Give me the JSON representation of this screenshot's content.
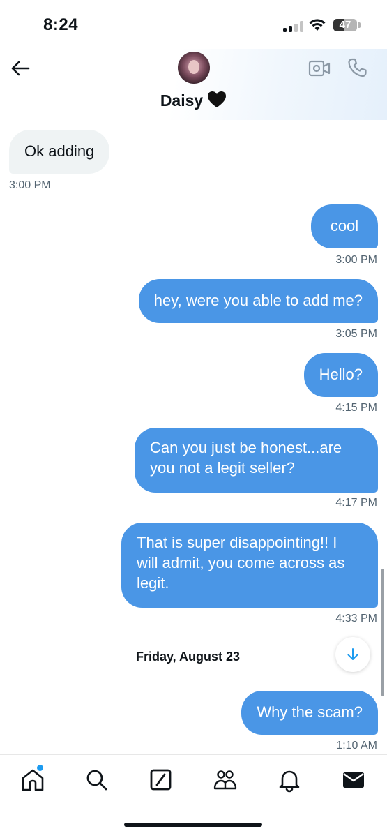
{
  "status_bar": {
    "time": "8:24",
    "battery_level": "47"
  },
  "header": {
    "contact_name": "Daisy",
    "name_emoji_icon": "black-heart-icon",
    "back_icon": "back-arrow-icon",
    "video_icon": "video-camera-icon",
    "phone_icon": "phone-icon"
  },
  "messages": [
    {
      "direction": "in",
      "text": "Ok adding",
      "time": "3:00 PM"
    },
    {
      "direction": "out",
      "text": "cool",
      "time": "3:00 PM"
    },
    {
      "direction": "out",
      "text": "hey, were you able to add me?",
      "time": "3:05 PM"
    },
    {
      "direction": "out",
      "text": "Hello?",
      "time": "4:15 PM"
    },
    {
      "direction": "out",
      "text": "Can you just be honest...are you not a legit seller?",
      "time": "4:17 PM"
    },
    {
      "direction": "out",
      "text": "That is super disappointing!! I will admit, you come across as legit.",
      "time": "4:33 PM"
    },
    {
      "direction": "out",
      "text": "Why the scam?",
      "time": "1:10 AM"
    }
  ],
  "date_divider": "Friday, August 23",
  "scroll_down_icon": "arrow-down-icon",
  "bottom_nav": {
    "items": [
      "home-icon",
      "search-icon",
      "grok-icon",
      "communities-icon",
      "notifications-icon",
      "messages-icon"
    ],
    "home_has_notification_dot": true
  },
  "colors": {
    "outgoing_bubble": "#4a96e6",
    "incoming_bubble": "#eff3f4",
    "accent": "#1d9bf0"
  }
}
